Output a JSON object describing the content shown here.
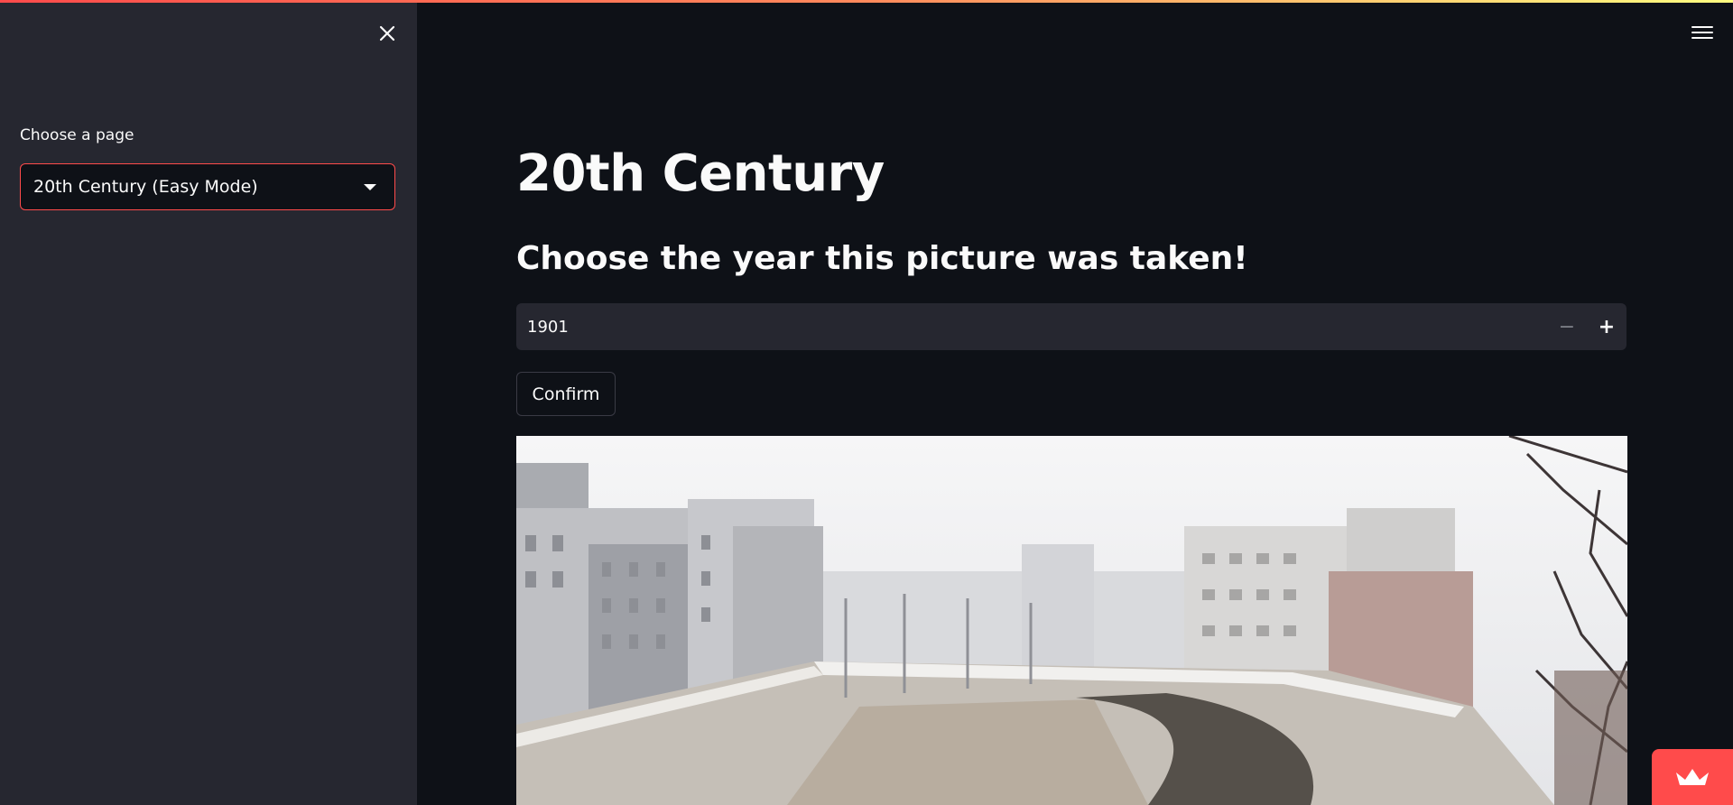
{
  "sidebar": {
    "label": "Choose a page",
    "selected_page": "20th Century (Easy Mode)",
    "close_icon": "close-icon"
  },
  "header": {
    "menu_icon": "hamburger-menu-icon",
    "accent_gradient": [
      "#ff4b4b",
      "#fffd80"
    ]
  },
  "main": {
    "title": "20th Century",
    "subtitle": "Choose the year this picture was taken!",
    "year_input": {
      "value": "1901",
      "minus_label": "−",
      "plus_label": "+"
    },
    "confirm_label": "Confirm",
    "photo_icon": "historical-photo"
  },
  "colors": {
    "background": "#0e1117",
    "sidebar": "#262730",
    "accent": "#ff4b4b",
    "text": "#fafafa"
  },
  "badge_icon": "streamlit-crown-icon"
}
